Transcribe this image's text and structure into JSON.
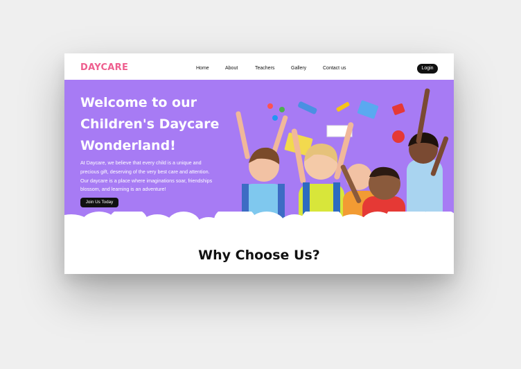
{
  "brand": {
    "logo": "DAYCARE",
    "accent": "#ee5e8e"
  },
  "nav": {
    "links": [
      "Home",
      "About",
      "Teachers",
      "Gallery",
      "Contact us"
    ],
    "login": "Login"
  },
  "hero": {
    "title_lines": [
      "Welcome to our",
      "Children's Daycare",
      "Wonderland!"
    ],
    "text_lines": [
      "At Daycare, we believe that every child is a unique and",
      "precious gift, deserving of the very best care and attention.",
      "Our daycare is a place where imaginations soar, friendships",
      "blossom, and learning is an adventure!"
    ],
    "cta": "Join Us Today",
    "background": "#a77bf4",
    "image": "group-of-cheering-children-photo"
  },
  "section": {
    "title": "Why Choose Us?"
  }
}
